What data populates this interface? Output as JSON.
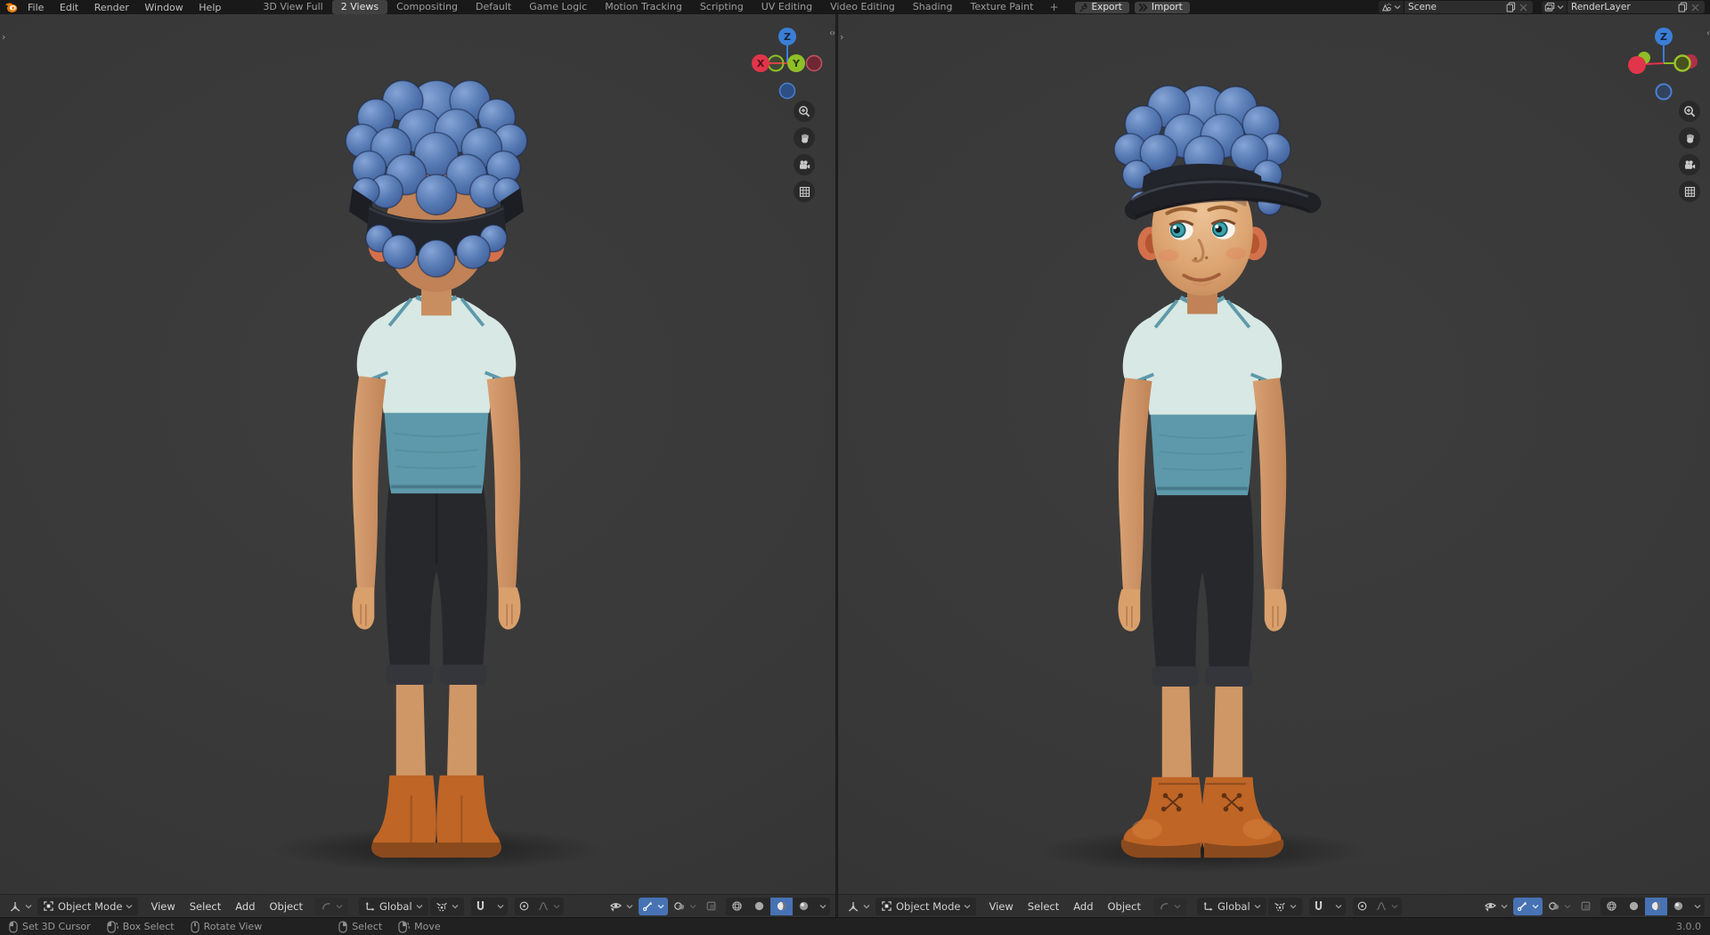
{
  "topbar": {
    "menus": [
      "File",
      "Edit",
      "Render",
      "Window",
      "Help"
    ],
    "tabs": [
      "3D View Full",
      "2 Views",
      "Compositing",
      "Default",
      "Game Logic",
      "Motion Tracking",
      "Scripting",
      "UV Editing",
      "Video Editing",
      "Shading",
      "Texture Paint"
    ],
    "active_tab": "2 Views",
    "add_tab_label": "+",
    "export_label": "Export",
    "import_label": "Import",
    "scene_label": "Scene",
    "render_layer_label": "RenderLayer"
  },
  "viewport_header": {
    "mode": "Object Mode",
    "menus": [
      "View",
      "Select",
      "Add",
      "Object"
    ],
    "orientation": "Global"
  },
  "gizmo": {
    "x_label": "X",
    "y_label": "Y",
    "z_label": "Z"
  },
  "statusbar": {
    "hints_left": [
      {
        "icon": "mouse-left-click-icon",
        "label": "Set 3D Cursor"
      },
      {
        "icon": "mouse-left-drag-icon",
        "label": "Box Select"
      },
      {
        "icon": "mouse-middle-click-icon",
        "label": "Rotate View"
      }
    ],
    "hints_right": [
      {
        "icon": "mouse-right-click-icon",
        "label": "Select"
      },
      {
        "icon": "mouse-right-drag-icon",
        "label": "Move"
      }
    ],
    "version": "3.0.0"
  },
  "colors": {
    "accent_blue": "#4772b3",
    "axis_x": "#e0354a",
    "axis_y": "#8fbe26",
    "axis_z": "#3a7fd6",
    "topbar_bg": "#191919",
    "header_bg": "#303030",
    "statusbar_bg": "#212121",
    "viewport_bg": "#383838"
  },
  "character_colors": {
    "hair": "#4b6da7",
    "cap": "#23252c",
    "skin": "#d9a06c",
    "shirt_top": "#d8e8e4",
    "shirt_bottom": "#5d99aa",
    "pants": "#27282c",
    "boots": "#bf6526",
    "eyes": "#3fa4ad"
  }
}
